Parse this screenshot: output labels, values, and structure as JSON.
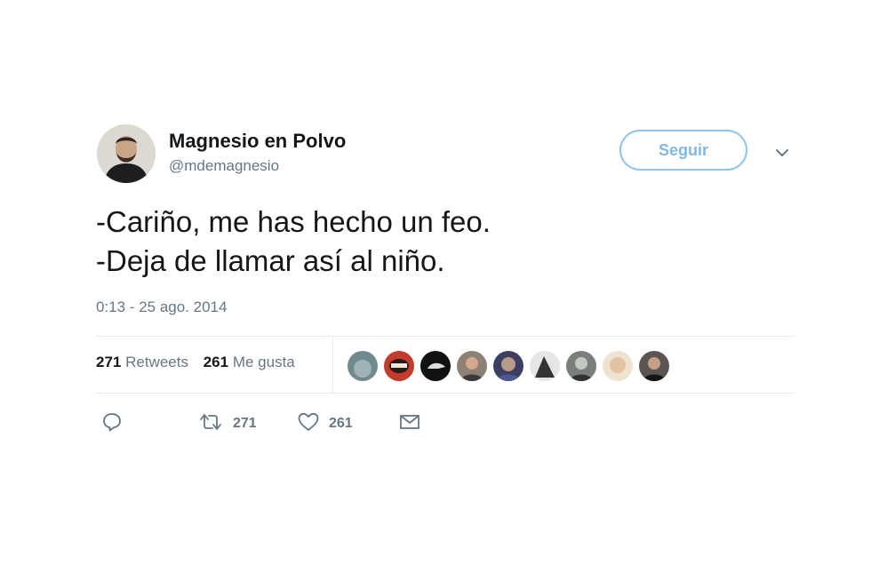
{
  "user": {
    "display_name": "Magnesio en Polvo",
    "handle": "@mdemagnesio"
  },
  "follow_button": {
    "label": "Seguir"
  },
  "tweet": {
    "lines": [
      "-Cariño, me has hecho un feo.",
      "-Deja de llamar así al niño."
    ],
    "timestamp": "0:13 - 25 ago. 2014"
  },
  "stats": {
    "retweets": {
      "count": "271",
      "label": "Retweets"
    },
    "likes": {
      "count": "261",
      "label": "Me gusta"
    }
  },
  "actions": {
    "reply": {
      "icon": "reply-icon"
    },
    "retweet": {
      "icon": "retweet-icon",
      "count": "271"
    },
    "like": {
      "icon": "heart-icon",
      "count": "261"
    },
    "message": {
      "icon": "envelope-icon"
    }
  },
  "colors": {
    "accent": "#8ec4ee",
    "muted": "#657786",
    "text": "#14171a"
  }
}
